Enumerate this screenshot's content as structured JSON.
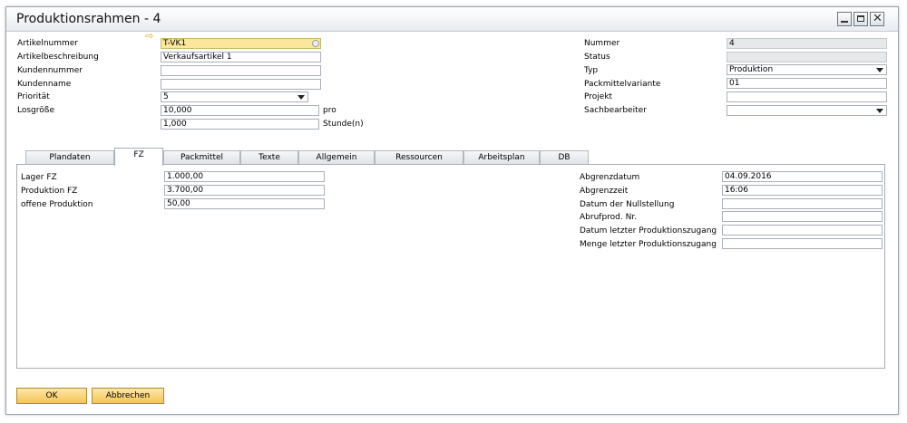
{
  "window": {
    "title": "Produktionsrahmen - 4"
  },
  "header_left": {
    "artikelnummer": {
      "label": "Artikelnummer",
      "value": "T-VK1"
    },
    "artikelbeschreibung": {
      "label": "Artikelbeschreibung",
      "value": "Verkaufsartikel 1"
    },
    "kundennummer": {
      "label": "Kundennummer",
      "value": ""
    },
    "kundenname": {
      "label": "Kundenname",
      "value": ""
    },
    "prioritaet": {
      "label": "Priorität",
      "value": "5"
    },
    "losgroesse": {
      "label": "Losgröße",
      "value": "10,000",
      "unit": "pro"
    },
    "zeit": {
      "value": "1,000",
      "unit": "Stunde(n)"
    }
  },
  "header_right": {
    "nummer": {
      "label": "Nummer",
      "value": "4"
    },
    "status": {
      "label": "Status",
      "value": ""
    },
    "typ": {
      "label": "Typ",
      "value": "Produktion"
    },
    "packmittelvariante": {
      "label": "Packmittelvariante",
      "value": "01"
    },
    "projekt": {
      "label": "Projekt",
      "value": ""
    },
    "sachbearbeiter": {
      "label": "Sachbearbeiter",
      "value": ""
    }
  },
  "tabs": [
    "Plandaten",
    "FZ",
    "Packmittel",
    "Texte",
    "Allgemein",
    "Ressourcen",
    "Arbeitsplan",
    "DB"
  ],
  "fz_left": [
    {
      "label": "Lager FZ",
      "value": "1.000,00"
    },
    {
      "label": "Produktion FZ",
      "value": "3.700,00"
    },
    {
      "label": "offene Produktion",
      "value": "50,00"
    }
  ],
  "fz_right": [
    {
      "label": "Abgrenzdatum",
      "value": "04.09.2016"
    },
    {
      "label": "Abgrenzzeit",
      "value": "16:06"
    },
    {
      "label": "Datum der Nullstellung",
      "value": ""
    },
    {
      "label": "Abrufprod. Nr.",
      "value": ""
    },
    {
      "label": "Datum letzter Produktionszugang",
      "value": ""
    },
    {
      "label": "Menge letzter Produktionszugang",
      "value": ""
    }
  ],
  "buttons": {
    "ok": "OK",
    "cancel": "Abbrechen"
  }
}
